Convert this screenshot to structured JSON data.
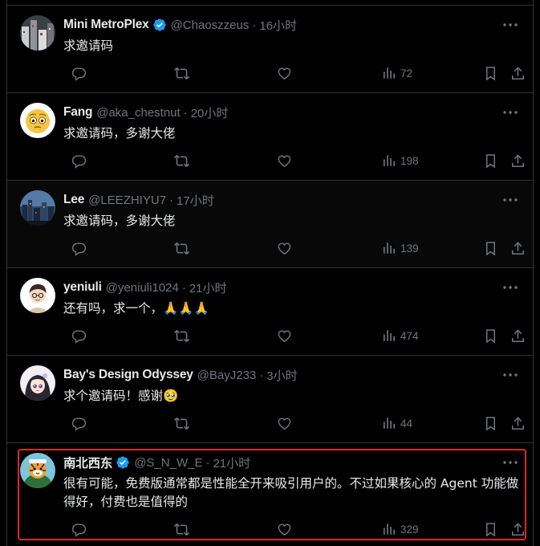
{
  "colors": {
    "background": "#000000",
    "text": "#e7e9ea",
    "muted": "#71767b",
    "divider": "#2f3336",
    "verified": "#1d9bf0",
    "highlight": "#e0252a"
  },
  "tweets": [
    {
      "name": "Mini MetroPlex",
      "verified": true,
      "handle": "@Chaoszzeus",
      "dot": "·",
      "time": "16小时",
      "text": "求邀请码",
      "views": "72",
      "avatar_icon": "city-night-avatar"
    },
    {
      "name": "Fang",
      "verified": false,
      "handle": "@aka_chestnut",
      "dot": "·",
      "time": "20小时",
      "text": "求邀请码，多谢大佬",
      "views": "198",
      "avatar_icon": "emoji-face-avatar"
    },
    {
      "name": "Lee",
      "verified": false,
      "handle": "@LEEZHIYU7",
      "dot": "·",
      "time": "17小时",
      "text": "求邀请码，多谢大佬",
      "views": "139",
      "avatar_icon": "skyline-avatar"
    },
    {
      "name": "yeniuli",
      "verified": false,
      "handle": "@yeniuli1024",
      "dot": "·",
      "time": "21小时",
      "text": "还有吗，求一个，🙏🙏🙏",
      "views": "474",
      "avatar_icon": "cartoon-boy-avatar"
    },
    {
      "name": "Bay's Design Odyssey",
      "verified": false,
      "handle": "@BayJ233",
      "dot": "·",
      "time": "3小时",
      "text": "求个邀请码！感谢🥹",
      "views": "44",
      "avatar_icon": "cartoon-girl-avatar"
    },
    {
      "name": "南北西东",
      "verified": true,
      "handle": "@S_N_W_E",
      "dot": "·",
      "time": "21小时",
      "text": "很有可能，免费版通常都是性能全开来吸引用户的。不过如果核心的 Agent 功能做得好，付费也是值得的",
      "views": "329",
      "avatar_icon": "tiger-avatar"
    }
  ]
}
